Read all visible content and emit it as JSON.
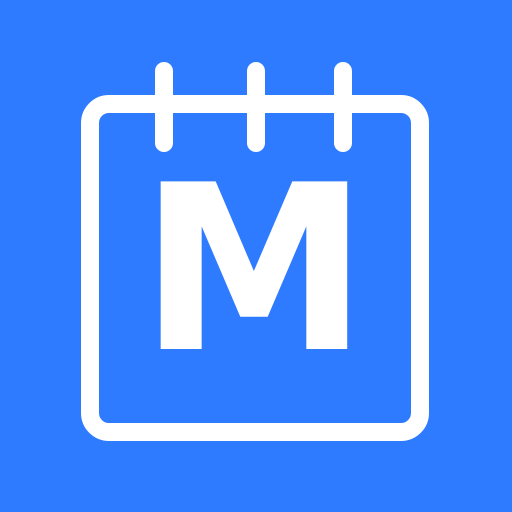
{
  "icon": {
    "name": "calendar-m-app-icon",
    "letter": "M",
    "background_color": "#2f7bff",
    "foreground_color": "#ffffff"
  }
}
